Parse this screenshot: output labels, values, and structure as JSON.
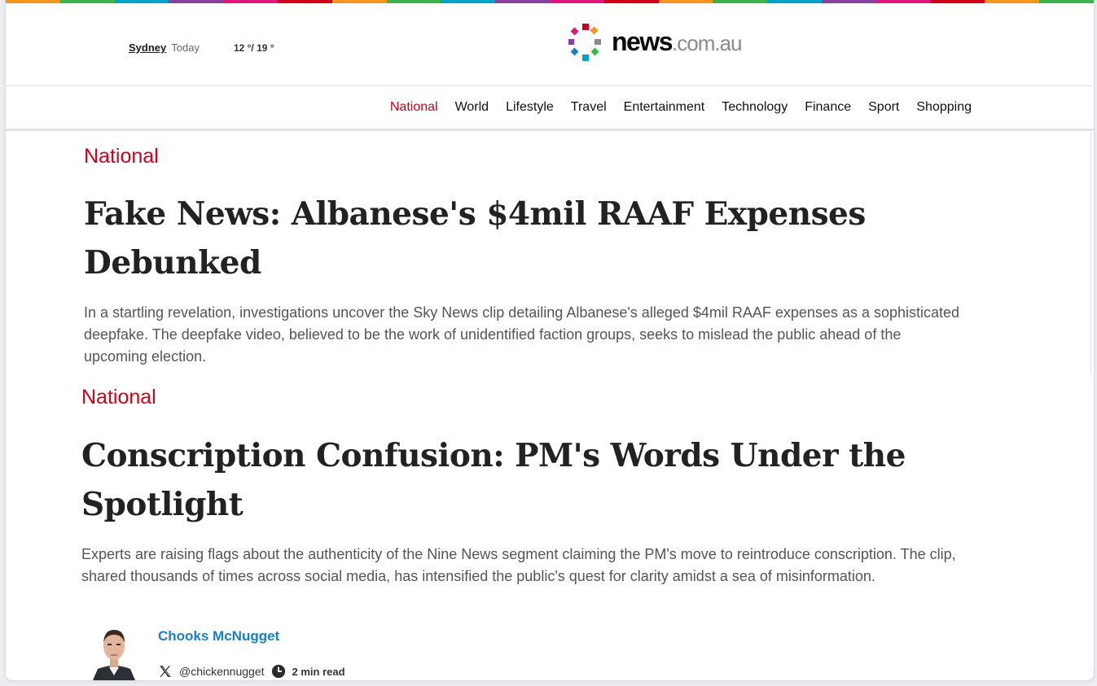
{
  "colors": {
    "accent_red": "#d0021b",
    "author_blue": "#1a7fc6",
    "rainbow": [
      "#f7941d",
      "#39b54a",
      "#00a3c4",
      "#8b3fa0",
      "#e3157a",
      "#d0021b",
      "#f7941d",
      "#39b54a",
      "#00a3c4",
      "#8b3fa0",
      "#e3157a",
      "#d0021b",
      "#f7941d",
      "#39b54a",
      "#00a3c4",
      "#8b3fa0",
      "#e3157a",
      "#d0021b",
      "#f7941d",
      "#39b54a"
    ]
  },
  "weather": {
    "city": "Sydney",
    "day": "Today",
    "temps": "12 °/ 19 °"
  },
  "logo": {
    "bold": "news",
    "light": ".com.au",
    "icon": "pinwheel-dots-logo"
  },
  "nav": {
    "items": [
      "National",
      "World",
      "Lifestyle",
      "Travel",
      "Entertainment",
      "Technology",
      "Finance",
      "Sport",
      "Shopping"
    ],
    "active": "National"
  },
  "articles": [
    {
      "category": "National",
      "headline": "Fake News: Albanese's $4mil RAAF Expenses Debunked",
      "summary": "In a startling revelation, investigations uncover the Sky News clip detailing Albanese's alleged $4mil RAAF expenses as a sophisticated deepfake. The deepfake video, believed to be the work of unidentified faction groups, seeks to mislead the public ahead of the upcoming election."
    },
    {
      "category": "National",
      "headline": "Conscription Confusion: PM's Words Under the Spotlight",
      "summary": "Experts are raising flags about the authenticity of the Nine News segment claiming the PM's move to reintroduce conscription. The clip, shared thousands of times across social media, has intensified the public's quest for clarity amidst a sea of misinformation."
    }
  ],
  "author": {
    "name": "Chooks McNugget",
    "handle": "@chickennugget",
    "read_time": "2 min read",
    "social_icon": "x-icon",
    "time_icon": "clock-icon"
  }
}
